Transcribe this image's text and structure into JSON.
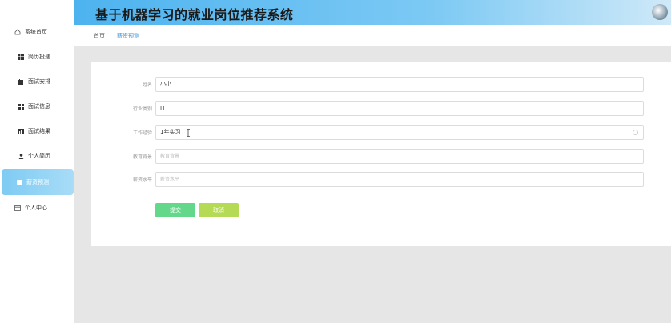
{
  "header": {
    "title": "基于机器学习的就业岗位推荐系统"
  },
  "breadcrumb": {
    "home": "首页",
    "current": "薪资预测"
  },
  "sidebar": {
    "items": [
      {
        "label": "系统首页",
        "icon": "home-icon",
        "active": false
      },
      {
        "label": "简历投递",
        "icon": "grid-icon",
        "active": false
      },
      {
        "label": "面试安排",
        "icon": "calendar-icon",
        "active": false
      },
      {
        "label": "面试信息",
        "icon": "blocks-icon",
        "active": false
      },
      {
        "label": "面试结果",
        "icon": "chart-icon",
        "active": false
      },
      {
        "label": "个人简历",
        "icon": "user-icon",
        "active": false
      },
      {
        "label": "薪资预测",
        "icon": "card-icon",
        "active": true
      },
      {
        "label": "个人中心",
        "icon": "window-icon",
        "active": false
      }
    ]
  },
  "form": {
    "name": {
      "label": "姓名",
      "value": "小小"
    },
    "industry": {
      "label": "行业类别",
      "value": "IT"
    },
    "experience": {
      "label": "工作经验",
      "value": "1年实习"
    },
    "education": {
      "label": "教育背景",
      "placeholder": "教育背景"
    },
    "salary": {
      "label": "薪资水平",
      "placeholder": "薪资水平"
    },
    "submit_label": "提交",
    "cancel_label": "取消"
  },
  "colors": {
    "header_start": "#4db3ef",
    "active_item": "#7ecbf3",
    "submit": "#64d88a",
    "cancel": "#b4da56",
    "link": "#3a8fd0"
  }
}
